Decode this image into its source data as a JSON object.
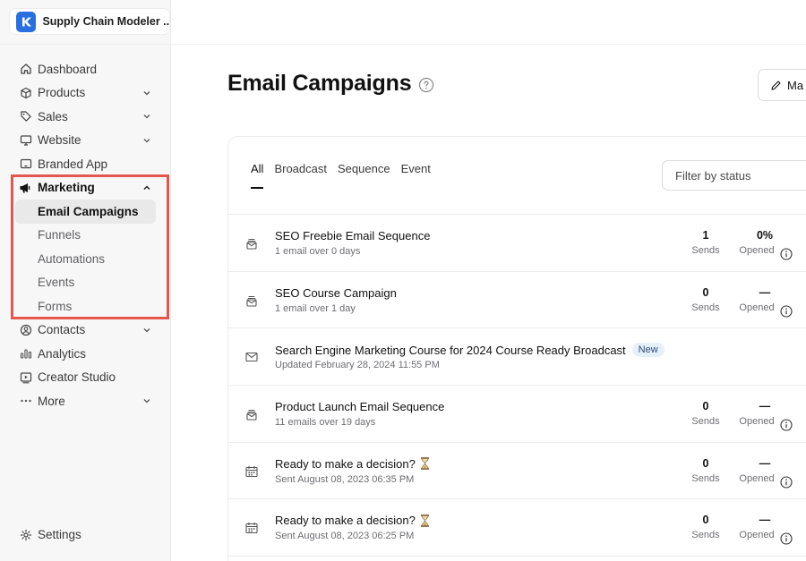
{
  "workspace": {
    "name": "Supply Chain Modeler ..."
  },
  "sidebar": {
    "items": [
      {
        "label": "Dashboard",
        "icon": "home-icon"
      },
      {
        "label": "Products",
        "icon": "cube-icon"
      },
      {
        "label": "Sales",
        "icon": "tag-icon"
      },
      {
        "label": "Website",
        "icon": "monitor-icon"
      },
      {
        "label": "Branded App",
        "icon": "tablet-icon"
      },
      {
        "label": "Marketing",
        "icon": "megaphone-icon"
      },
      {
        "label": "Contacts",
        "icon": "user-icon"
      },
      {
        "label": "Analytics",
        "icon": "bar-chart-icon"
      },
      {
        "label": "Creator Studio",
        "icon": "play-icon"
      },
      {
        "label": "More",
        "icon": "more-icon"
      }
    ],
    "marketing_sub": [
      "Email Campaigns",
      "Funnels",
      "Automations",
      "Events",
      "Forms"
    ],
    "settings": "Settings"
  },
  "main": {
    "title": "Email Campaigns",
    "manage_label": "Ma",
    "tabs": [
      "All",
      "Broadcast",
      "Sequence",
      "Event"
    ],
    "filter_placeholder": "Filter by status",
    "stat_labels": {
      "sends": "Sends",
      "opened": "Opened"
    },
    "rows": [
      {
        "icon": "sequence-icon",
        "title": "SEO Freebie Email Sequence",
        "sub": "1 email over 0 days",
        "sends": "1",
        "opened": "0%"
      },
      {
        "icon": "sequence-icon",
        "title": "SEO Course Campaign",
        "sub": "1 email over 1 day",
        "sends": "0",
        "opened": "—"
      },
      {
        "icon": "mail-icon",
        "title": "Search Engine Marketing Course for 2024 Course Ready Broadcast",
        "sub": "Updated February 28, 2024 11:55 PM",
        "badge": "New"
      },
      {
        "icon": "sequence-icon",
        "title": "Product Launch Email Sequence",
        "sub": "11 emails over 19 days",
        "sends": "0",
        "opened": "—"
      },
      {
        "icon": "calendar-icon",
        "title": "Ready to make a decision?",
        "sub": "Sent August 08, 2023 06:35 PM",
        "sends": "0",
        "opened": "—"
      },
      {
        "icon": "calendar-icon",
        "title": "Ready to make a decision?",
        "sub": "Sent August 08, 2023 06:25 PM",
        "sends": "0",
        "opened": "—"
      }
    ]
  },
  "colors": {
    "accent": "#2a6fe0",
    "highlight": "#e5574e"
  }
}
